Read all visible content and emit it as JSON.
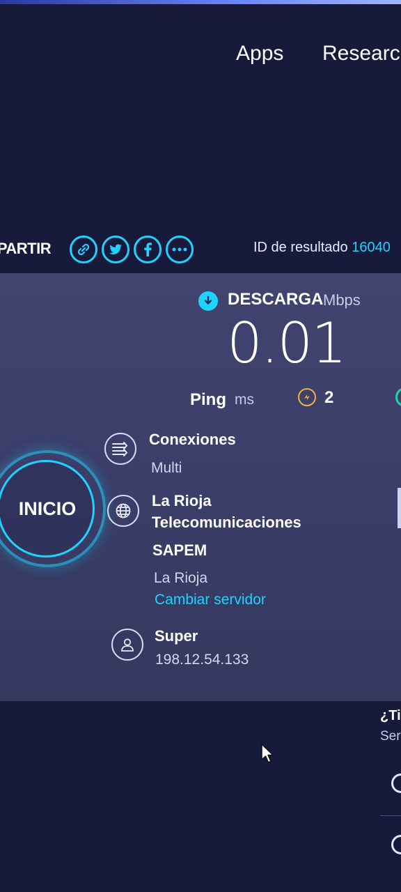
{
  "nav": {
    "apps": "Apps",
    "research": "Researcl"
  },
  "share": {
    "label": "MPARTIR",
    "buttons": [
      {
        "icon": "link-icon"
      },
      {
        "icon": "twitter-icon"
      },
      {
        "icon": "facebook-icon"
      },
      {
        "icon": "more-icon"
      }
    ],
    "result_label": "ID de resultado",
    "result_id": "16040"
  },
  "download": {
    "label": "DESCARGA",
    "unit": "Mbps",
    "value": "0.01"
  },
  "ping": {
    "label": "Ping",
    "unit": "ms",
    "value": "2"
  },
  "start": {
    "label": "INICIO"
  },
  "connections": {
    "title": "Conexiones",
    "value": "Multi"
  },
  "server": {
    "name_line1": "La Rioja",
    "name_line2": "Telecomunicaciones",
    "name_line3": "SAPEM",
    "location": "La Rioja",
    "change_link": "Cambiar servidor"
  },
  "user": {
    "name": "Super",
    "ip": "198.12.54.133"
  },
  "footer": {
    "question": "¿Ti",
    "sub": "Ser"
  },
  "colors": {
    "accent": "#1fd3ff",
    "ping_accent": "#f5b13c",
    "background": "#171a3a",
    "panel": "#3d416b"
  }
}
